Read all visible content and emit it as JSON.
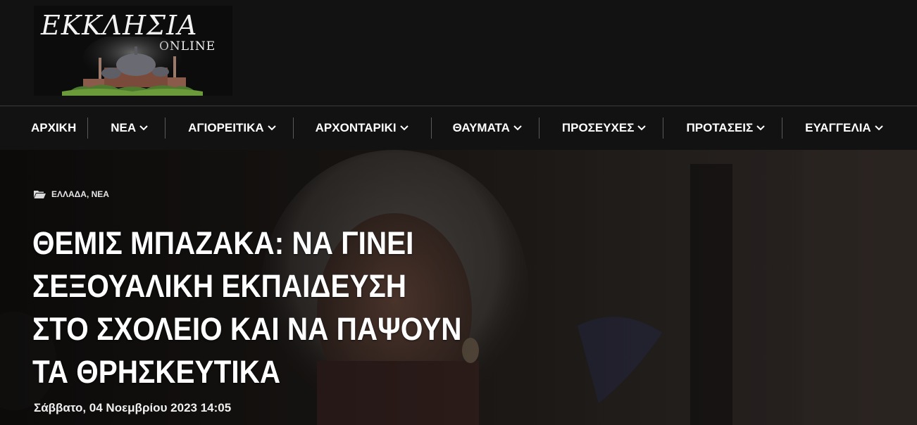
{
  "site": {
    "logo_title": "ΕΚΚΛΗΣΙΑ",
    "logo_subtitle": "ONLINE"
  },
  "nav": {
    "items": [
      {
        "label": "ΑΡΧΙΚΗ",
        "has_dropdown": false
      },
      {
        "label": "ΝΕΑ",
        "has_dropdown": true
      },
      {
        "label": "ΑΓΙΟΡΕΙΤΙΚΑ",
        "has_dropdown": true
      },
      {
        "label": "ΑΡΧΟΝΤΑΡΙΚΙ",
        "has_dropdown": true
      },
      {
        "label": "ΘΑΥΜΑΤΑ",
        "has_dropdown": true
      },
      {
        "label": "ΠΡΟΣΕΥΧΕΣ",
        "has_dropdown": true
      },
      {
        "label": "ΠΡΟΤΑΣΕΙΣ",
        "has_dropdown": true
      },
      {
        "label": "ΕΥΑΓΓΕΛΙΑ",
        "has_dropdown": true
      }
    ]
  },
  "article": {
    "categories": "ΕΛΛΑΔΑ, ΝΕΑ",
    "title": "ΘΕΜΙΣ ΜΠΑΖΑΚΑ: ΝΑ ΓΙΝΕΙ ΣΕΞΟΥΑΛΙΚΗ ΕΚΠΑΙΔΕΥΣΗ ΣΤΟ ΣΧΟΛΕΙΟ ΚΑΙ ΝΑ ΠΑΨΟΥΝ ΤΑ ΘΡΗΣΚΕΥΤΙΚΑ",
    "date": "Σάββατο, 04 Νοεμβρίου 2023 14:05"
  },
  "colors": {
    "background": "#111111",
    "text": "#ffffff",
    "separator": "#5a5a5a"
  },
  "icons": {
    "category": "folder-open-icon",
    "dropdown": "chevron-down-icon"
  }
}
